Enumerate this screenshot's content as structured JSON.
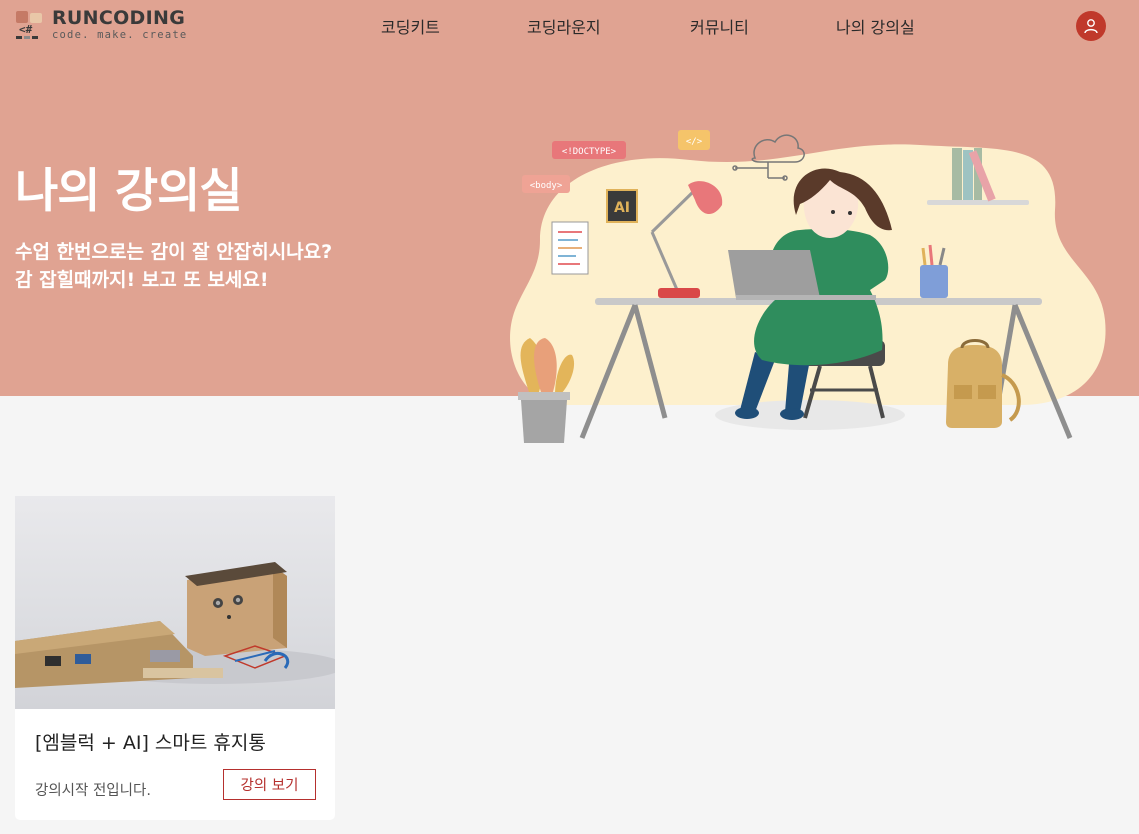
{
  "header": {
    "logo": {
      "name": "RUNCODING",
      "tagline": "code. make. create"
    },
    "nav": [
      "코딩키트",
      "코딩라운지",
      "커뮤니티",
      "나의 강의실"
    ],
    "avatar_icon": "user-icon"
  },
  "hero": {
    "title": "나의 강의실",
    "subtitle_line1": "수업 한번으로는 감이 잘 안잡히시나요?",
    "subtitle_line2": "감 잡힐때까지! 보고 또 보세요!",
    "illustration_tags": {
      "doctype": "<!DOCTYPE>",
      "body": "<body>",
      "code": "</>",
      "ai": "AI"
    }
  },
  "courses": [
    {
      "title": "[엠블럭 + AI] 스마트 휴지통",
      "status": "강의시작 전입니다.",
      "button": "강의 보기"
    }
  ],
  "colors": {
    "hero_bg": "#e0a392",
    "accent": "#b5302e",
    "page_bg": "#f5f5f5"
  }
}
